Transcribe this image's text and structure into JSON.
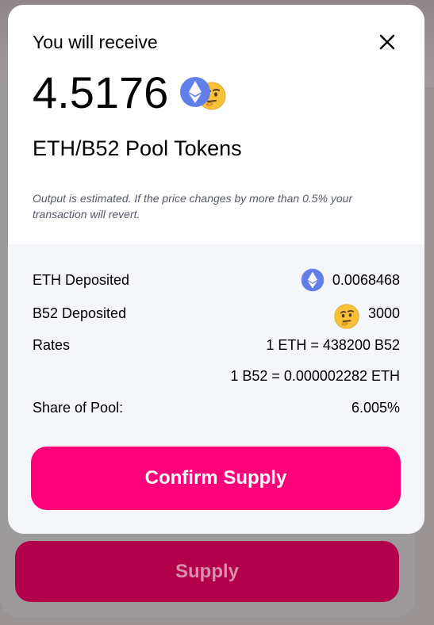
{
  "modal": {
    "title": "You will receive",
    "amount": "4.5176",
    "pool_label": "ETH/B52 Pool Tokens",
    "note": "Output is estimated. If the price changes by more than 0.5% your transaction will revert.",
    "close_icon": "close-icon",
    "token_icons": [
      "eth-icon",
      "b52-thinking-emoji-icon"
    ]
  },
  "details": {
    "eth_deposited": {
      "label": "ETH Deposited",
      "value": "0.0068468",
      "icon": "eth-icon"
    },
    "b52_deposited": {
      "label": "B52 Deposited",
      "value": "3000",
      "icon": "thinking-emoji-icon"
    },
    "rates": {
      "label": "Rates",
      "value_1": "1 ETH = 438200 B52",
      "value_2": "1 B52 = 0.000002282 ETH"
    },
    "share": {
      "label": "Share of Pool:",
      "value": "6.005%"
    }
  },
  "confirm_button": "Confirm Supply",
  "background": {
    "supply_button": "Supply"
  },
  "colors": {
    "accent": "#ff007a",
    "accent_disabled": "#b3004a",
    "eth_blue": "#627eea",
    "emoji_yellow": "#f7c23a"
  }
}
